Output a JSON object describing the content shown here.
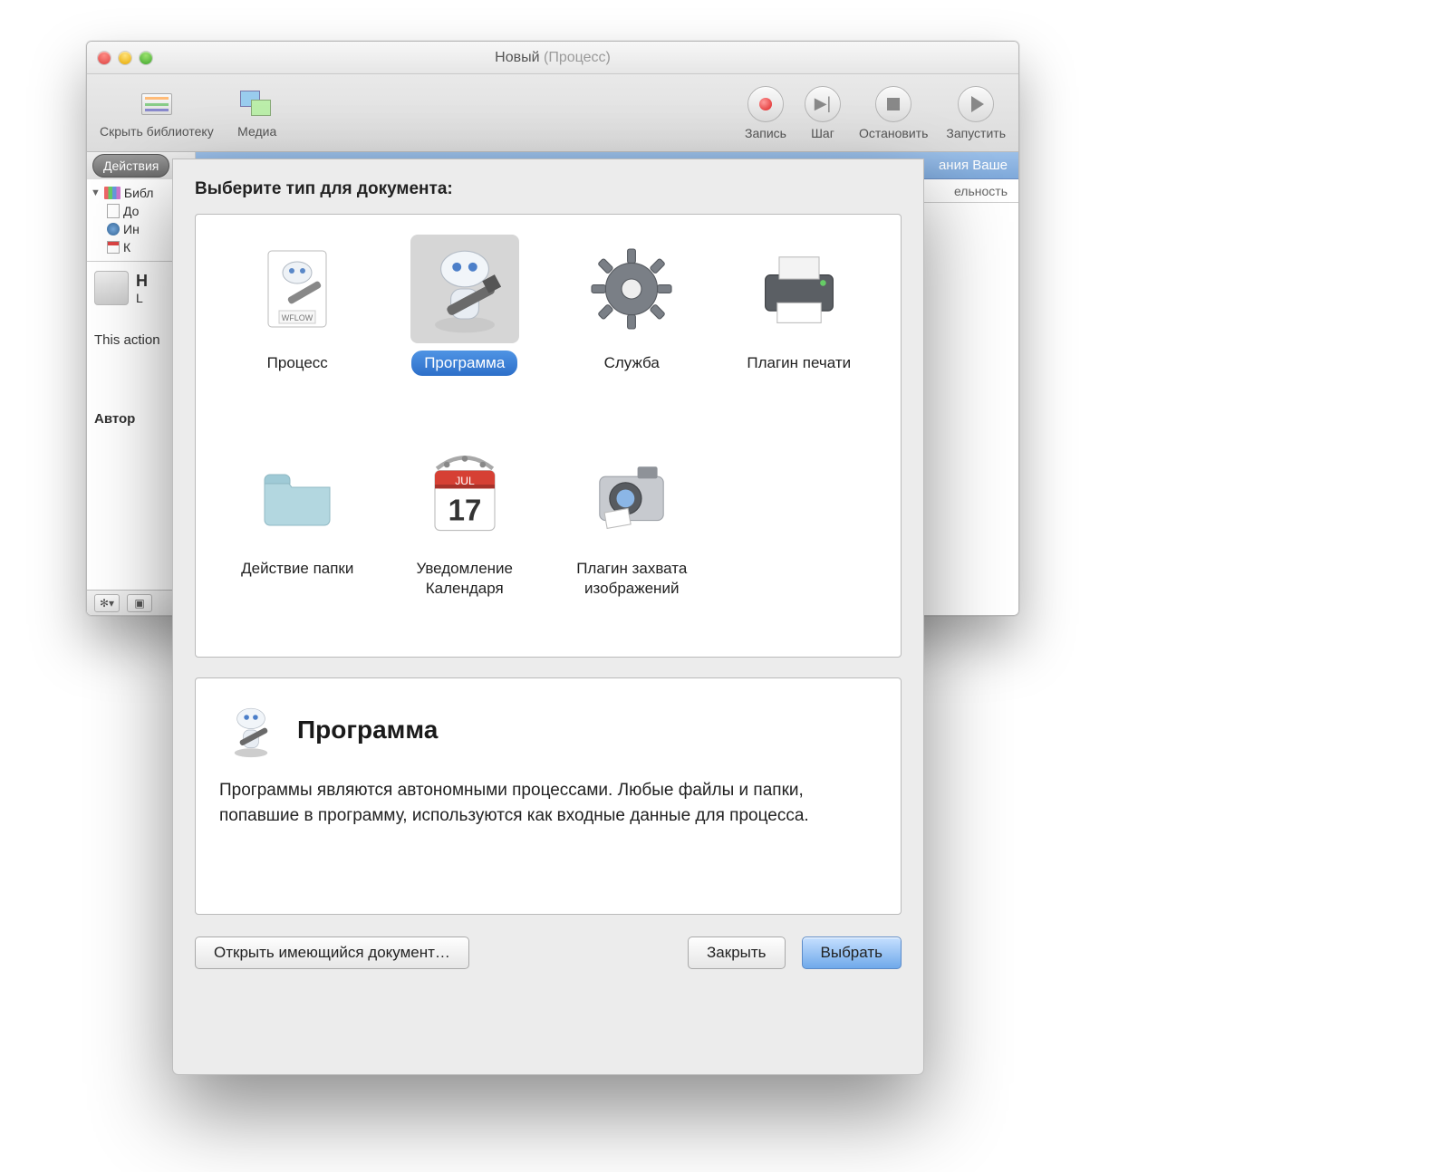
{
  "window": {
    "title_main": "Новый",
    "title_sub": "(Процесс)"
  },
  "toolbar": {
    "hide_library": "Скрыть библиотеку",
    "media": "Медиа",
    "record": "Запись",
    "step": "Шаг",
    "stop": "Остановить",
    "play": "Запустить"
  },
  "sidebar": {
    "tab_actions": "Действия",
    "library": "Библ",
    "rows": [
      {
        "label": "До"
      },
      {
        "label": "Ин"
      },
      {
        "label": "К"
      }
    ],
    "info_h": "Н",
    "info_l": "L",
    "action_text": "This action",
    "author_label": "Автор"
  },
  "right_pane": {
    "header_suffix": "ания Ваше",
    "sub_suffix": "ельность"
  },
  "sheet": {
    "prompt": "Выберите тип для документа:",
    "options": [
      {
        "id": "workflow",
        "label": "Процесс",
        "badge": "WFLOW"
      },
      {
        "id": "application",
        "label": "Программа",
        "selected": true
      },
      {
        "id": "service",
        "label": "Служба"
      },
      {
        "id": "print_plugin",
        "label": "Плагин печати"
      },
      {
        "id": "folder_action",
        "label": "Действие папки"
      },
      {
        "id": "calendar_alarm",
        "label": "Уведомление Календаря",
        "day": "17",
        "month": "JUL"
      },
      {
        "id": "image_capture",
        "label": "Плагин захвата изображений"
      }
    ],
    "description": {
      "title": "Программа",
      "text": "Программы являются автономными процессами. Любые файлы и папки, попавшие в программу, используются как входные данные для процесса."
    },
    "buttons": {
      "open_existing": "Открыть имеющийся документ…",
      "close": "Закрыть",
      "choose": "Выбрать"
    }
  }
}
